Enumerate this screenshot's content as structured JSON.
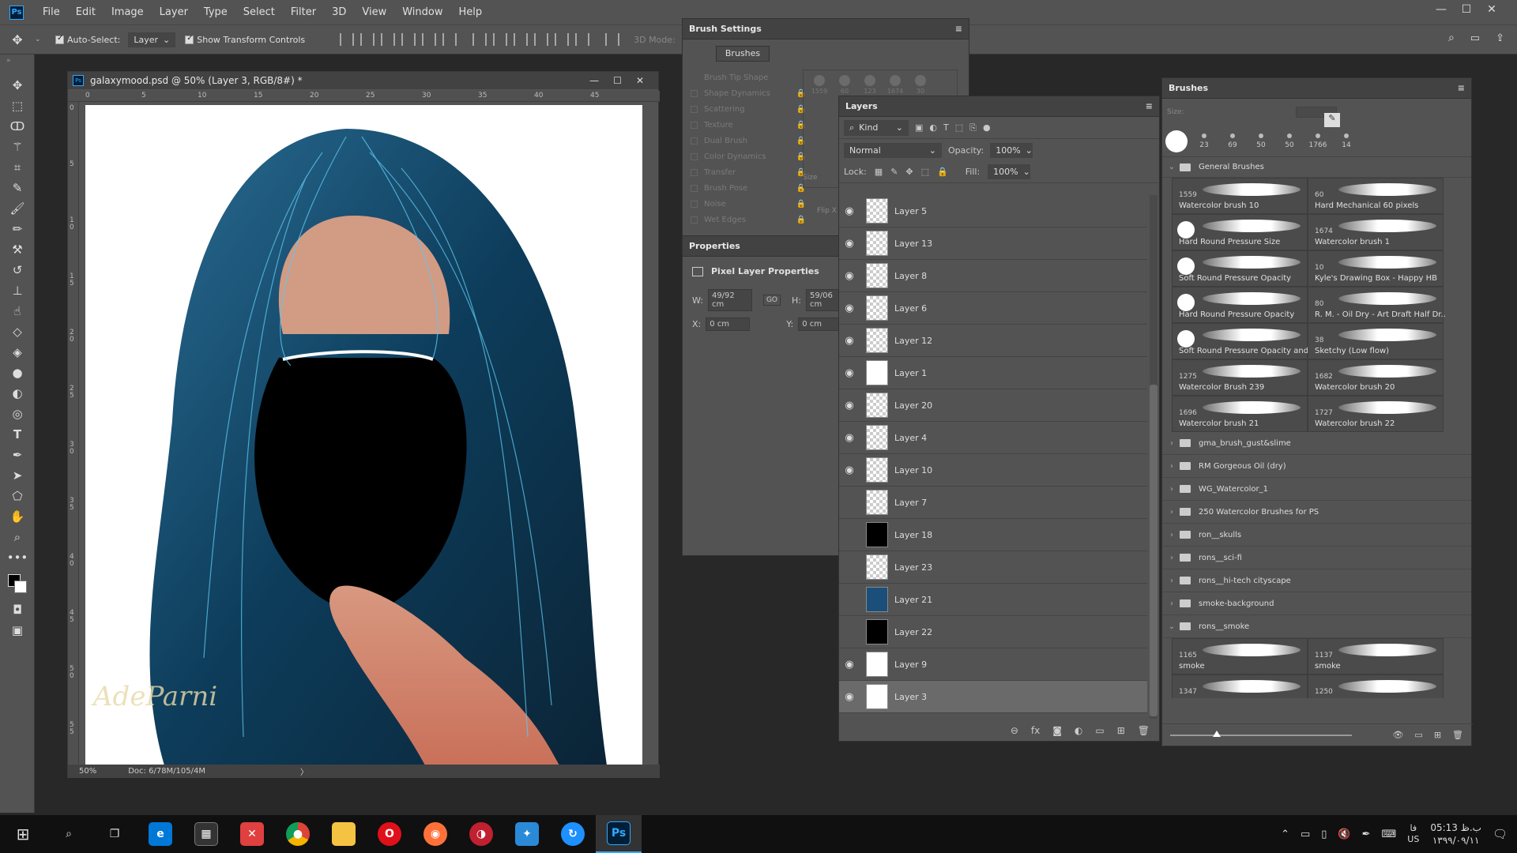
{
  "app": {
    "logo": "Ps",
    "menu": [
      "File",
      "Edit",
      "Image",
      "Layer",
      "Type",
      "Select",
      "Filter",
      "3D",
      "View",
      "Window",
      "Help"
    ]
  },
  "options": {
    "auto_select_label": "Auto-Select:",
    "auto_select_value": "Layer",
    "transform_label": "Show Transform Controls",
    "mode_3d": "3D Mode:"
  },
  "document": {
    "title": "galaxymood.psd @ 50% (Layer 3, RGB/8#) *",
    "zoom": "50%",
    "doc_info": "Doc: 6/78M/105/4M",
    "ruler_h": [
      "0",
      "5",
      "10",
      "15",
      "20",
      "25",
      "30",
      "35",
      "40",
      "45"
    ],
    "ruler_v": [
      "0",
      "5",
      "1 0",
      "1 5",
      "2 0",
      "2 5",
      "3 0",
      "3 5",
      "4 0",
      "4 5",
      "5 0",
      "5 5"
    ],
    "signature": "AdeParni"
  },
  "brush_settings": {
    "title": "Brush Settings",
    "brushes_button": "Brushes",
    "items": [
      "Brush Tip Shape",
      "Shape Dynamics",
      "Scattering",
      "Texture",
      "Dual Brush",
      "Color Dynamics",
      "Transfer",
      "Brush Pose",
      "Noise",
      "Wet Edges"
    ],
    "tip_numbers": [
      "1559",
      "60",
      "123",
      "1674",
      "30"
    ],
    "size_label": "Size",
    "flip_label": "Flip X"
  },
  "properties": {
    "title": "Properties",
    "subtitle": "Pixel Layer Properties",
    "w_label": "W:",
    "w_value": "49/92 cm",
    "h_label": "H:",
    "h_value": "59/06 cm",
    "x_label": "X:",
    "x_value": "0 cm",
    "y_label": "Y:",
    "y_value": "0 cm",
    "link": "GO"
  },
  "layers": {
    "title": "Layers",
    "kind": "Kind",
    "blend": "Normal",
    "opacity_label": "Opacity:",
    "opacity_value": "100%",
    "lock_label": "Lock:",
    "fill_label": "Fill:",
    "fill_value": "100%",
    "rows": [
      {
        "name": "Layer 5",
        "visible": true
      },
      {
        "name": "Layer 13",
        "visible": true
      },
      {
        "name": "Layer 8",
        "visible": true
      },
      {
        "name": "Layer 6",
        "visible": true
      },
      {
        "name": "Layer 12",
        "visible": true
      },
      {
        "name": "Layer 1",
        "visible": true
      },
      {
        "name": "Layer 20",
        "visible": true
      },
      {
        "name": "Layer 4",
        "visible": true
      },
      {
        "name": "Layer 10",
        "visible": true
      },
      {
        "name": "Layer 7",
        "visible": false
      },
      {
        "name": "Layer 18",
        "visible": false
      },
      {
        "name": "Layer 23",
        "visible": false
      },
      {
        "name": "Layer 21",
        "visible": false
      },
      {
        "name": "Layer 22",
        "visible": false
      },
      {
        "name": "Layer 9",
        "visible": true
      },
      {
        "name": "Layer 3",
        "visible": true,
        "selected": true
      }
    ]
  },
  "brushes": {
    "title": "Brushes",
    "size_label": "Size:",
    "presets": [
      "23",
      "69",
      "50",
      "50",
      "1766",
      "14"
    ],
    "group": "General Brushes",
    "items": [
      {
        "num": "1559",
        "label": "Watercolor brush 10"
      },
      {
        "num": "60",
        "label": "Hard Mechanical 60 pixels"
      },
      {
        "num": "",
        "label": "Hard Round Pressure Size"
      },
      {
        "num": "1674",
        "label": "Watercolor brush 1"
      },
      {
        "num": "",
        "label": "Soft Round Pressure Opacity"
      },
      {
        "num": "10",
        "label": "Kyle's Drawing Box - Happy HB"
      },
      {
        "num": "",
        "label": "Hard Round Pressure Opacity"
      },
      {
        "num": "80",
        "label": "R. M. - Oil Dry - Art Draft Half Dr..."
      },
      {
        "num": "",
        "label": "Soft Round Pressure Opacity and..."
      },
      {
        "num": "38",
        "label": "Sketchy (Low flow)"
      },
      {
        "num": "1275",
        "label": "Watercolor Brush 239"
      },
      {
        "num": "1682",
        "label": "Watercolor brush 20"
      },
      {
        "num": "1696",
        "label": "Watercolor brush 21"
      },
      {
        "num": "1727",
        "label": "Watercolor brush 22"
      }
    ],
    "folders": [
      "gma_brush_gust&slime",
      "RM Gorgeous Oil (dry)",
      "WG_Watercolor_1",
      "250 Watercolor Brushes for PS",
      "ron__skulls",
      "rons__sci-fi",
      "rons__hi-tech cityscape",
      "smoke-background"
    ],
    "open_folder": "rons__smoke",
    "smoke_items": [
      {
        "num": "1165",
        "label": "smoke"
      },
      {
        "num": "1137",
        "label": "smoke"
      },
      {
        "num": "1347",
        "label": ""
      },
      {
        "num": "1250",
        "label": ""
      }
    ]
  },
  "taskbar": {
    "time": "05:13 ب.ظ",
    "date": "۱۳۹۹/۰۹/۱۱",
    "lang_top": "فا",
    "lang_bottom": "US"
  }
}
